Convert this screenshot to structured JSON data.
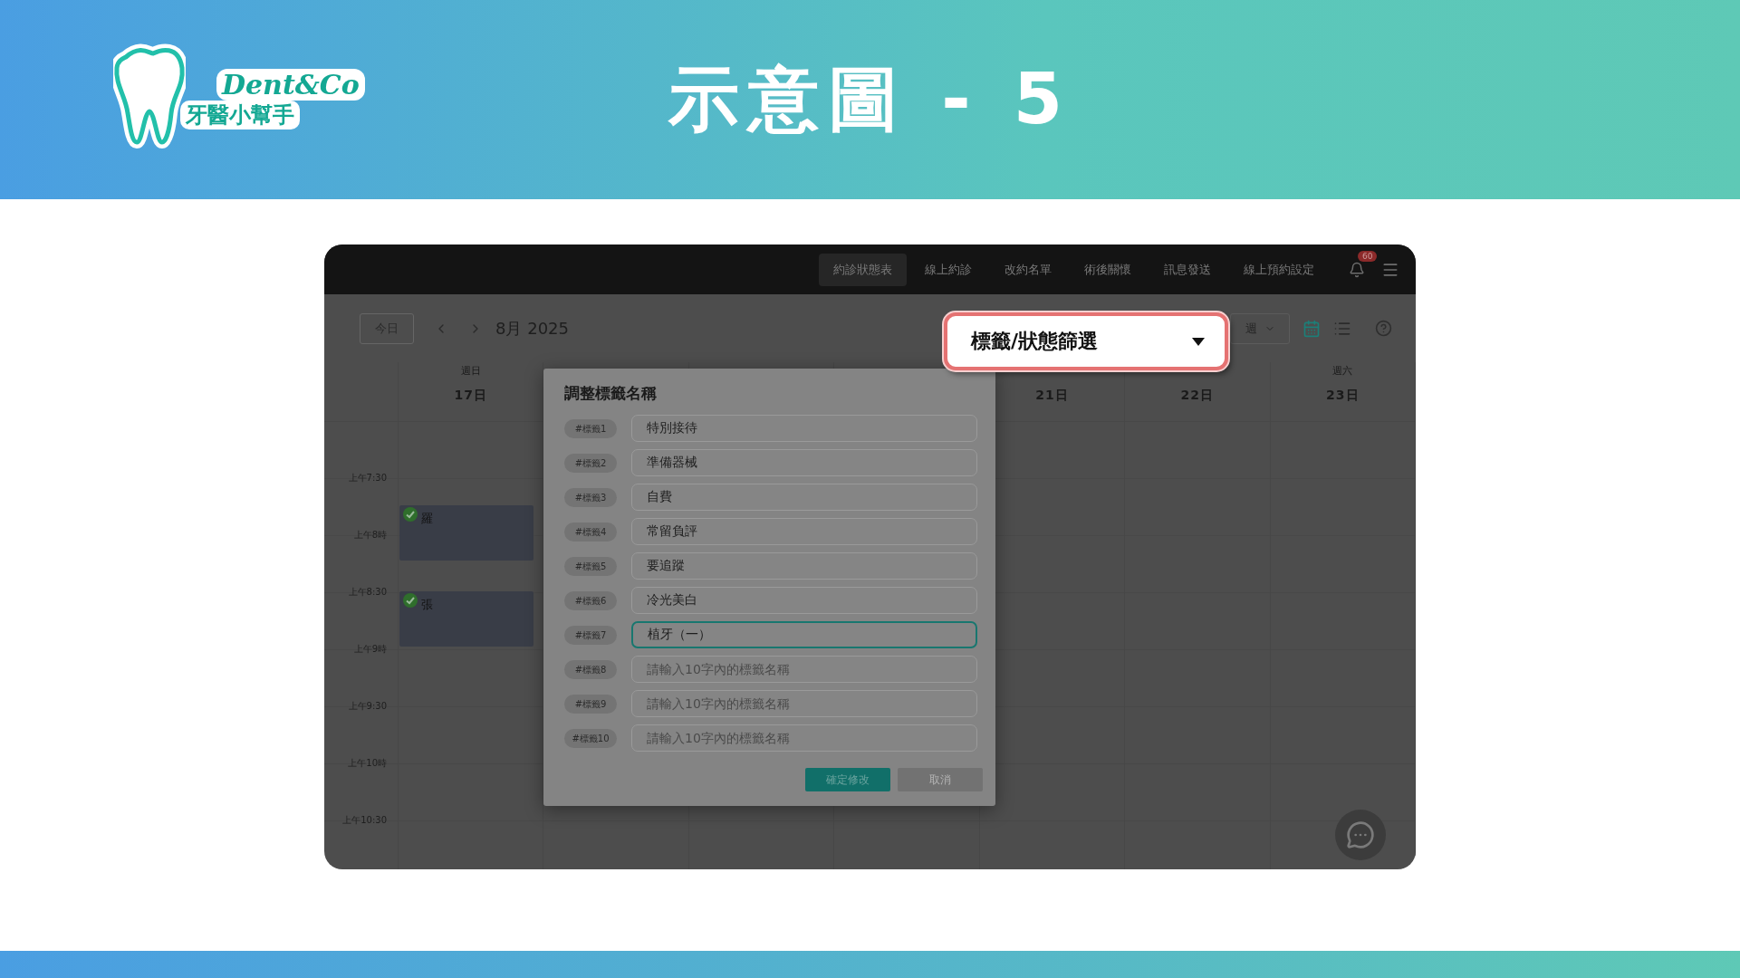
{
  "banner": {
    "logo": {
      "wordmark": "Dent&Co",
      "name": "牙醫小幫手"
    },
    "title": "示意圖 - 5"
  },
  "app": {
    "nav": [
      {
        "label": "約診狀態表",
        "selected": true
      },
      {
        "label": "線上約診",
        "selected": false
      },
      {
        "label": "改約名單",
        "selected": false
      },
      {
        "label": "術後關懷",
        "selected": false
      },
      {
        "label": "訊息發送",
        "selected": false
      },
      {
        "label": "線上預約設定",
        "selected": false
      }
    ],
    "notification_badge": "60",
    "toolbar": {
      "today": "今日",
      "month": "8月 2025",
      "view_select": "週",
      "views": [
        {
          "kind": "calendar",
          "selected": true
        },
        {
          "kind": "list",
          "selected": false
        }
      ]
    },
    "calendar": {
      "days_left": [
        {
          "weekday": "週日",
          "date": "17日"
        }
      ],
      "days_right": [
        {
          "date": "21日"
        },
        {
          "date": "22日"
        },
        {
          "weekday": "週六",
          "date": "23日"
        }
      ],
      "times": [
        "上午7:30",
        "上午8時",
        "上午8:30",
        "上午9時",
        "上午9:30",
        "上午10時",
        "上午10:30"
      ],
      "events": [
        {
          "name": "羅",
          "confirmed": true
        },
        {
          "name": "張",
          "confirmed": true
        }
      ]
    },
    "dialog": {
      "title": "調整標籤名稱",
      "tags": [
        {
          "tag": "#標籤1",
          "value": "特別接待",
          "focused": false
        },
        {
          "tag": "#標籤2",
          "value": "準備器械",
          "focused": false
        },
        {
          "tag": "#標籤3",
          "value": "自費",
          "focused": false
        },
        {
          "tag": "#標籤4",
          "value": "常留負評",
          "focused": false
        },
        {
          "tag": "#標籤5",
          "value": "要追蹤",
          "focused": false
        },
        {
          "tag": "#標籤6",
          "value": "冷光美白",
          "focused": false
        },
        {
          "tag": "#標籤7",
          "value": "植牙（一）",
          "focused": true
        },
        {
          "tag": "#標籤8",
          "placeholder": "請輸入10字內的標籤名稱",
          "focused": false
        },
        {
          "tag": "#標籤9",
          "placeholder": "請輸入10字內的標籤名稱",
          "focused": false
        },
        {
          "tag": "#標籤10",
          "placeholder": "請輸入10字內的標籤名稱",
          "focused": false
        }
      ],
      "confirm": "確定修改",
      "cancel": "取消"
    },
    "callout": {
      "label": "標籤/狀態篩選"
    }
  }
}
